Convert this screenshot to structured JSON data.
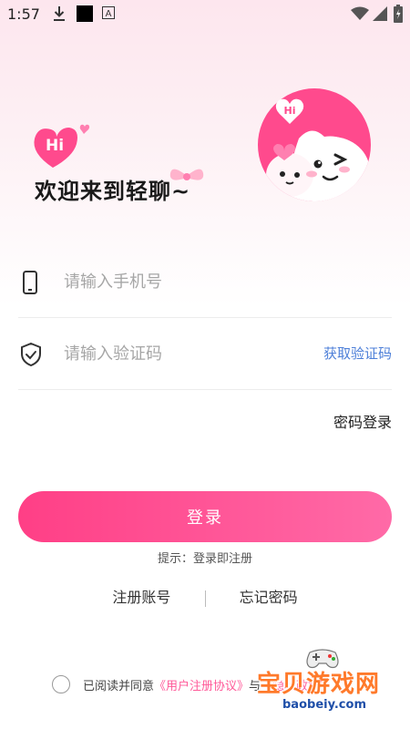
{
  "status_bar": {
    "time": "1:57"
  },
  "welcome": {
    "hi_badge": "Hi",
    "title": "欢迎来到轻聊~"
  },
  "mascot": {
    "hi_badge": "Hi"
  },
  "phone_field": {
    "placeholder": "请输入手机号",
    "value": ""
  },
  "code_field": {
    "placeholder": "请输入验证码",
    "value": "",
    "get_code_label": "获取验证码"
  },
  "password_login_label": "密码登录",
  "login_button_label": "登录",
  "hint_text": "提示：登录即注册",
  "links": {
    "register": "注册账号",
    "forgot": "忘记密码"
  },
  "agreement": {
    "prefix": "已阅读并同意",
    "user_agreement": "《用户注册协议》",
    "connector": "与",
    "privacy_policy": "《隐私政策》"
  },
  "watermark": {
    "cn": "宝贝游戏网",
    "en": "baobeiy.com"
  },
  "colors": {
    "accent": "#ff4a8d",
    "link_blue": "#4d7fd8",
    "background_top": "#fde6ee"
  },
  "icons": [
    "download-icon",
    "app-square-icon",
    "a-badge-icon",
    "wifi-icon",
    "signal-icon",
    "battery-icon",
    "phone-icon",
    "shield-check-icon",
    "heart-hi-icon",
    "mascot-avatar"
  ]
}
